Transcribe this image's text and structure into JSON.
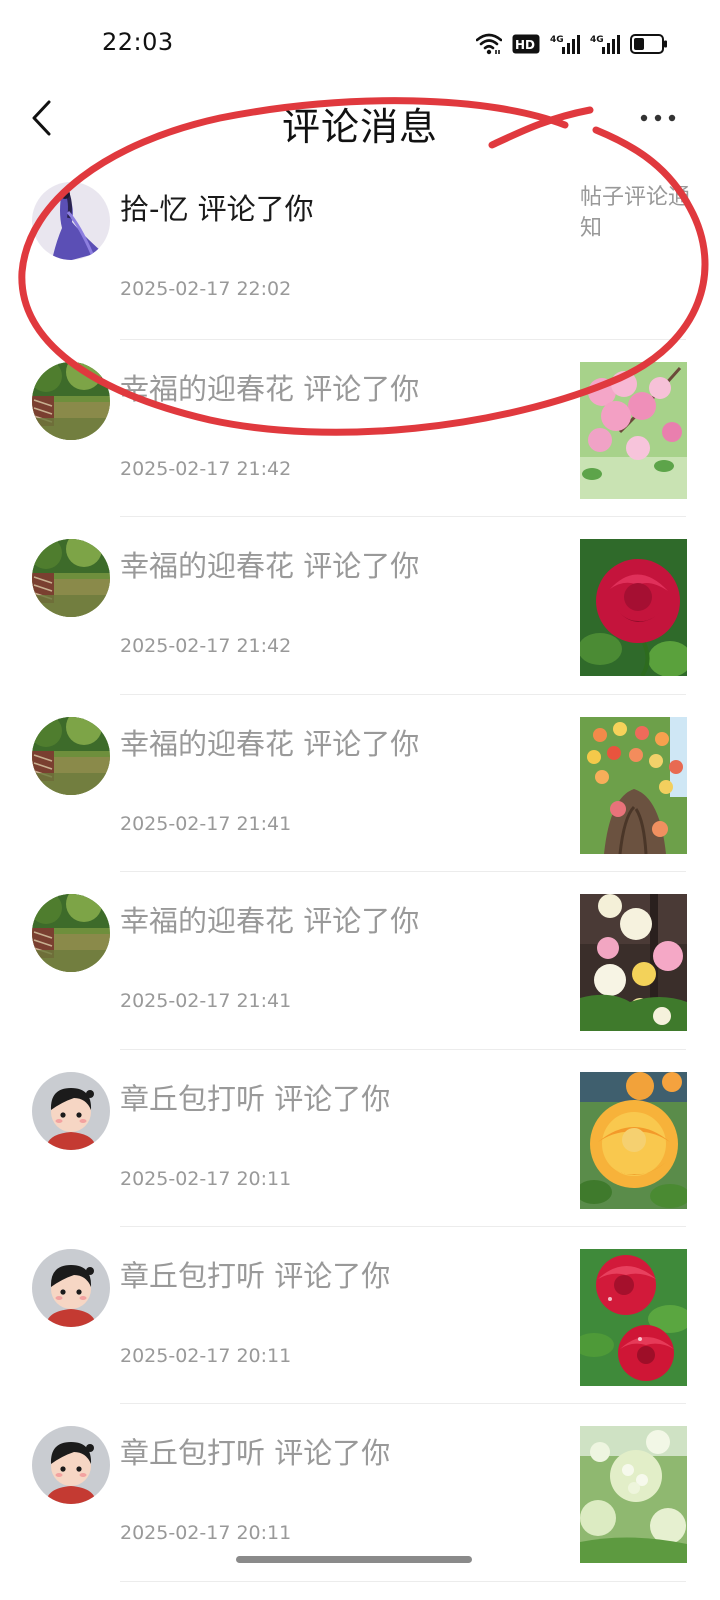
{
  "status_bar": {
    "time": "22:03",
    "icons": [
      "wifi-icon",
      "hd-icon",
      "signal-4g-icon",
      "signal-4g-icon",
      "battery-icon"
    ],
    "hd_text": "HD",
    "net_text": "4G"
  },
  "header": {
    "title": "评论消息",
    "back_icon": "chevron-left-icon",
    "more_icon": "more-dots-icon"
  },
  "messages": [
    {
      "title": "拾-忆 评论了你",
      "time": "2025-02-17 22:02",
      "type_label": "帖子评论通知",
      "read": false,
      "avatar": "purple-figure",
      "thumb": null
    },
    {
      "title": "幸福的迎春花 评论了你",
      "time": "2025-02-17 21:42",
      "read": true,
      "avatar": "pond-park",
      "thumb": "pink-blossoms"
    },
    {
      "title": "幸福的迎春花 评论了你",
      "time": "2025-02-17 21:42",
      "read": true,
      "avatar": "pond-park",
      "thumb": "red-rose"
    },
    {
      "title": "幸福的迎春花 评论了你",
      "time": "2025-02-17 21:41",
      "read": true,
      "avatar": "pond-park",
      "thumb": "flower-tree"
    },
    {
      "title": "幸福的迎春花 评论了你",
      "time": "2025-02-17 21:41",
      "read": true,
      "avatar": "pond-park",
      "thumb": "mixed-roses"
    },
    {
      "title": "章丘包打听 评论了你",
      "time": "2025-02-17 20:11",
      "read": true,
      "avatar": "cartoon-kid",
      "thumb": "yellow-peony"
    },
    {
      "title": "章丘包打听 评论了你",
      "time": "2025-02-17 20:11",
      "read": true,
      "avatar": "cartoon-kid",
      "thumb": "red-roses-dew"
    },
    {
      "title": "章丘包打听 评论了你",
      "time": "2025-02-17 20:11",
      "read": true,
      "avatar": "cartoon-kid",
      "thumb": "white-hydrangea"
    }
  ],
  "colors": {
    "annotation": "#e0393e",
    "read_text": "#999999",
    "unread_text": "#1a1a1a"
  }
}
